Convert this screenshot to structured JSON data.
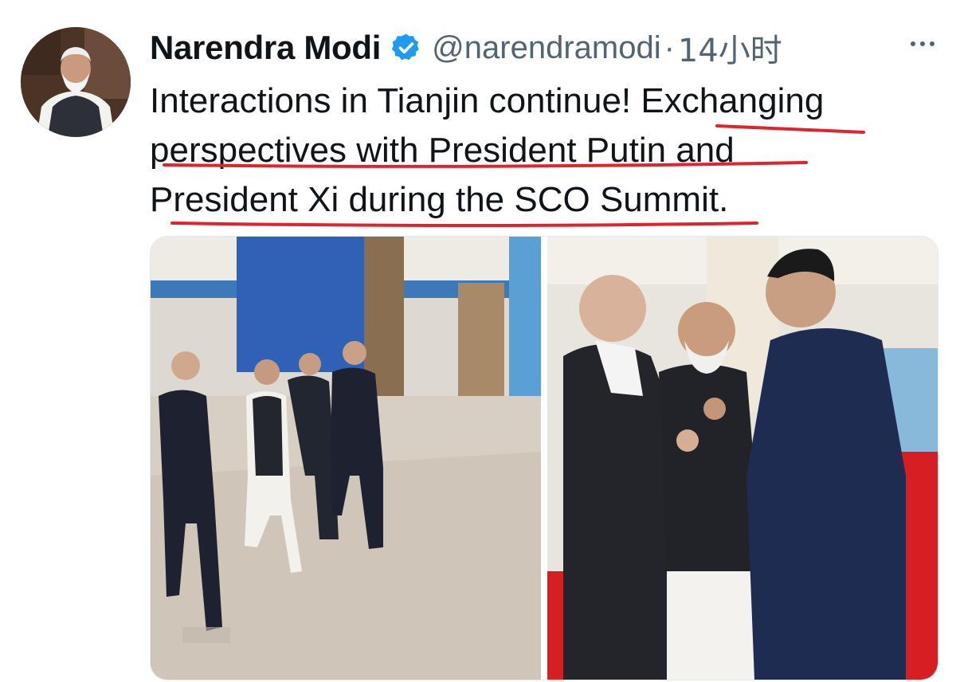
{
  "tweet": {
    "author_name": "Narendra Modi",
    "handle": "@narendramodi",
    "separator": "·",
    "time": "14小时",
    "text_lines": [
      "Interactions in Tianjin continue! Exchanging",
      "perspectives with President Putin and",
      "President Xi during the SCO Summit."
    ]
  },
  "icons": {
    "verified": "verified-badge-icon",
    "more": "more-options-icon"
  },
  "colors": {
    "verified_blue": "#1d9bf0",
    "secondary_text": "#536471",
    "annotation_red": "#e0232c"
  }
}
